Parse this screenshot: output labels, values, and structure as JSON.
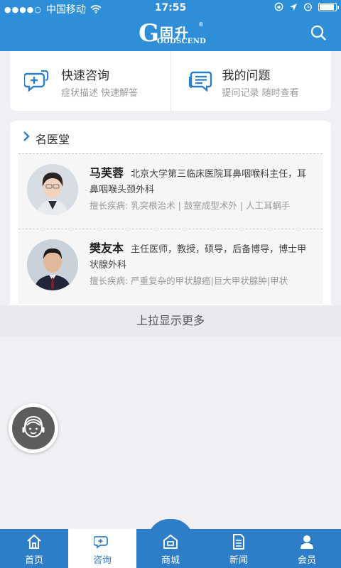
{
  "status_bar": {
    "carrier": "中国移动",
    "time": "17:55"
  },
  "header": {
    "logo_letter": "G",
    "logo_cn": "固升",
    "logo_reg": "®",
    "logo_en": "OODSCEND"
  },
  "quick_actions": [
    {
      "title": "快速咨询",
      "subtitle": "症状描述  快速解答",
      "icon": "chat-plus-icon"
    },
    {
      "title": "我的问题",
      "subtitle": "提问记录  随时查看",
      "icon": "message-list-icon"
    }
  ],
  "doctors_section": {
    "title": "名医堂",
    "doctors": [
      {
        "name": "马芙蓉",
        "description": "北京大学第三临床医院耳鼻咽喉科主任，耳鼻咽喉头颈外科",
        "specialty": "擅长疾病: 乳突根治术 | 鼓室成型术外 | 人工耳蜗手"
      },
      {
        "name": "樊友本",
        "description": "主任医师，教授，硕导，后备博导，博士甲状腺外科",
        "specialty": "擅长疾病: 严重复杂的甲状腺癌|巨大甲状腺肿|甲状"
      }
    ]
  },
  "load_more": "上拉显示更多",
  "floating_button": {
    "icon": "customer-service-icon"
  },
  "tabs": [
    {
      "label": "首页",
      "icon": "home-icon",
      "active": false
    },
    {
      "label": "咨询",
      "icon": "consult-icon",
      "active": true
    },
    {
      "label": "商城",
      "icon": "shop-icon",
      "active": false
    },
    {
      "label": "新闻",
      "icon": "news-icon",
      "active": false
    },
    {
      "label": "会员",
      "icon": "member-icon",
      "active": false
    }
  ],
  "colors": {
    "primary": "#2e8fd8",
    "tabbar": "#2e7dc7",
    "background": "#efeff4"
  }
}
